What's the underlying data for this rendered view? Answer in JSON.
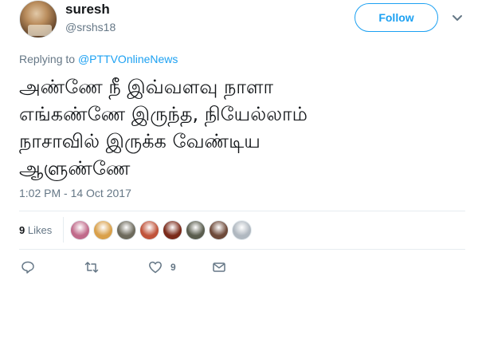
{
  "user": {
    "display_name": "suresh",
    "handle": "@srshs18"
  },
  "follow_button": {
    "label": "Follow"
  },
  "reply_context": {
    "prefix": "Replying to ",
    "mention": "@PTTVOnlineNews"
  },
  "tweet": {
    "text": "அண்ணே நீ இவ்வளவு நாளா\nஎங்கண்ணே இருந்த, நியேல்லாம்\nநாசாவில் இருக்க வேண்டிய\nஆளுண்ணே",
    "timestamp": "1:02 PM - 14 Oct 2017"
  },
  "likes": {
    "count": "9",
    "label": " Likes",
    "avatars": [
      "#c06a8a",
      "#d9a04a",
      "#6d6a5c",
      "#c0533a",
      "#7a2a1a",
      "#5a5d4e",
      "#6e4a3a",
      "#b0b8c0"
    ]
  },
  "actions": {
    "like_count": "9"
  },
  "colors": {
    "accent": "#1da1f2",
    "secondary_text": "#657786",
    "icon": "#657786"
  },
  "icons": {
    "caret": "chevron-down-icon",
    "reply": "reply-icon",
    "retweet": "retweet-icon",
    "like": "heart-icon",
    "dm": "envelope-icon"
  }
}
